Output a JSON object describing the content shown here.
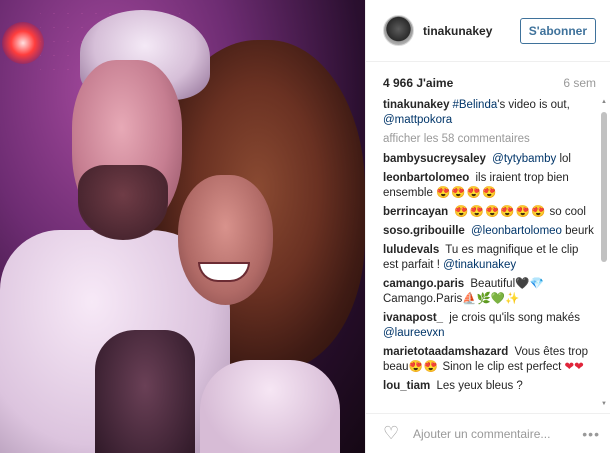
{
  "author": {
    "username": "tinakunakey",
    "follow_label": "S'abonner"
  },
  "stats": {
    "likes": "4 966 J'aime",
    "time": "6 sem"
  },
  "caption": {
    "user": "tinakunakey",
    "hashtag": "#Belinda",
    "text": "'s video is out,",
    "mention": "@mattpokora"
  },
  "more_comments": "afficher les 58 commentaires",
  "comments": [
    {
      "user": "bambysucreysaley",
      "mention": "@tytybamby",
      "text": "lol"
    },
    {
      "user": "leonbartolomeo",
      "text": "ils iraient trop bien ensemble",
      "emoji": "😍😍😍😍"
    },
    {
      "user": "berrincayan",
      "emoji": "😍😍😍😍😍😍",
      "text": "so cool"
    },
    {
      "user": "soso.gribouille",
      "mention": "@leonbartolomeo",
      "text": "beurk"
    },
    {
      "user": "luludevals",
      "text": "Tu es magnifique et le clip est parfait !",
      "mention": "@tinakunakey"
    },
    {
      "user": "camango.paris",
      "text": "Beautiful",
      "emoji": "🖤💎",
      "text2": "Camango.Paris",
      "emoji2": "⛵🌿💚✨"
    },
    {
      "user": "ivanapost_",
      "text": "je crois qu'ils song makés",
      "mention": "@laureevxn"
    },
    {
      "user": "marietotaadamshazard",
      "text": "Vous êtes trop beau",
      "emoji": "😍😍",
      "text2": "Sinon le clip est perfect",
      "emoji2": "❤❤"
    },
    {
      "user": "lou_tiam",
      "text": "Les yeux bleus ?"
    }
  ],
  "footer": {
    "placeholder": "Ajouter un commentaire...",
    "like_icon": "heart-outline-icon",
    "more_icon": "more-options-icon",
    "more_glyph": "•••",
    "heart_glyph": "♡"
  },
  "colors": {
    "link": "#003569",
    "follow": "#3f729b",
    "muted": "#999999"
  }
}
